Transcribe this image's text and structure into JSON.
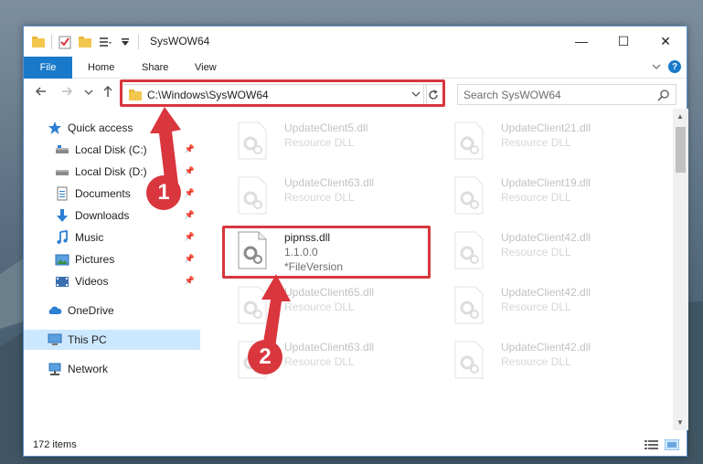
{
  "window": {
    "title": "SysWOW64",
    "controls": {
      "minimize": "—",
      "maximize": "☐",
      "close": "✕"
    }
  },
  "ribbon": {
    "tabs": [
      "File",
      "Home",
      "Share",
      "View"
    ]
  },
  "address": {
    "path": "C:\\Windows\\SysWOW64",
    "search_placeholder": "Search SysWOW64"
  },
  "nav": {
    "items": [
      {
        "label": "Quick access",
        "icon": "star-icon"
      },
      {
        "label": "Local Disk (C:)",
        "icon": "drive-icon"
      },
      {
        "label": "Local Disk (D:)",
        "icon": "drive-icon"
      },
      {
        "label": "Documents",
        "icon": "documents-icon"
      },
      {
        "label": "Downloads",
        "icon": "downloads-icon"
      },
      {
        "label": "Music",
        "icon": "music-icon"
      },
      {
        "label": "Pictures",
        "icon": "pictures-icon"
      },
      {
        "label": "Videos",
        "icon": "videos-icon"
      },
      {
        "label": "OneDrive",
        "icon": "cloud-icon"
      },
      {
        "label": "This PC",
        "icon": "computer-icon"
      },
      {
        "label": "Network",
        "icon": "network-icon"
      }
    ]
  },
  "files": [
    {
      "name": "UpdateClient5.dll",
      "type": "Resource DLL"
    },
    {
      "name": "UpdateClient21.dll",
      "type": "Resource DLL"
    },
    {
      "name": "UpdateClient63.dll",
      "type": "Resource DLL"
    },
    {
      "name": "UpdateClient19.dll",
      "type": "Resource DLL"
    },
    {
      "name": "pipnss.dll",
      "version": "1.1.0.0",
      "file_version": "*FileVersion"
    },
    {
      "name": "UpdateClient42.dll",
      "type": "Resource DLL"
    },
    {
      "name": "UpdateClient65.dll",
      "type": "Resource DLL"
    },
    {
      "name": "UpdateClient42.dll",
      "type": "Resource DLL"
    },
    {
      "name": "UpdateClient63.dll",
      "type": "Resource DLL"
    },
    {
      "name": "UpdateClient42.dll",
      "type": "Resource DLL"
    }
  ],
  "status": {
    "count": "172 items"
  },
  "annotations": {
    "step1": "1",
    "step2": "2",
    "color": "#d9363e"
  }
}
